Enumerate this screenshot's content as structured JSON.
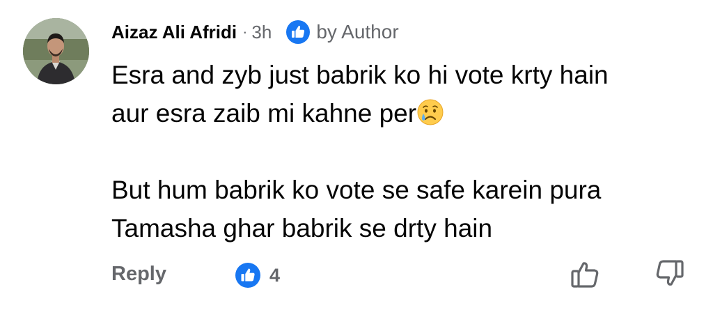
{
  "comment": {
    "author": "Aizaz Ali Afridi",
    "separator": "·",
    "time": "3h",
    "author_badge": "by Author",
    "text_lines": [
      "Esra and zyb just babrik ko hi vote krty hain",
      "aur esra zaib mi kahne per"
    ],
    "text_lines_2": [
      "But hum babrik ko vote se safe karein pura",
      "Tamasha ghar babrik se drty hain"
    ],
    "emoji": "crying-face"
  },
  "actions": {
    "reply_label": "Reply",
    "reaction_icon": "like-icon",
    "reaction_count": "4"
  },
  "colors": {
    "like_blue": "#1877f2",
    "secondary_text": "#65676b",
    "primary_text": "#050505"
  }
}
